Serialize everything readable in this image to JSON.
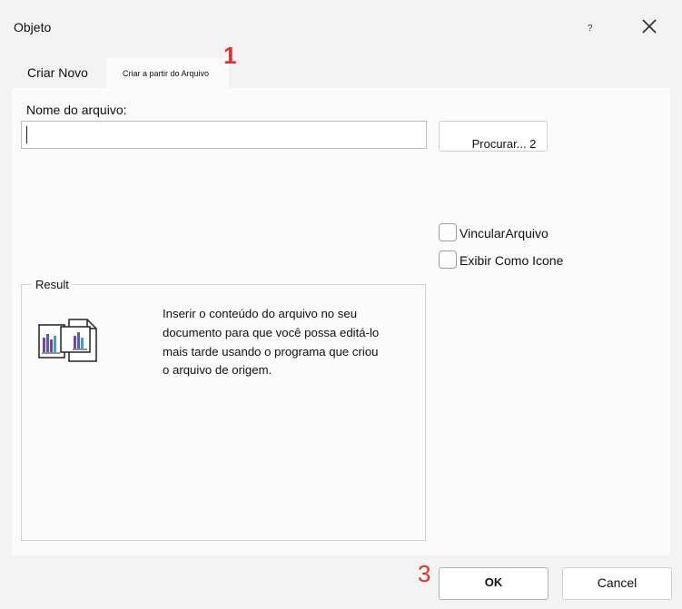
{
  "window": {
    "title": "Objeto",
    "help_glyph": "?",
    "close_icon": "close-icon"
  },
  "tabs": [
    {
      "label": "Criar Novo",
      "active": false
    },
    {
      "label": "Criar a partir do Arquivo",
      "active": true
    }
  ],
  "annotations": {
    "marker_1": "1",
    "marker_3": "3"
  },
  "file": {
    "label": "Nome do arquivo:",
    "value": "",
    "browse_label": "Procurar... 2"
  },
  "options": {
    "link_label": "VincularArquivo",
    "link_checked": false,
    "icon_label": "Exibir Como Icone",
    "icon_checked": false
  },
  "result": {
    "legend": "Result",
    "text": "Inserir o conteúdo do arquivo no seu documento para que você possa editá-lo mais tarde usando o programa  que criou o arquivo de origem.",
    "icon": "embedded-document-icon"
  },
  "footer": {
    "ok_label": "OK",
    "cancel_label": "Cancel"
  },
  "colors": {
    "dialog_bg": "#f3f3f3",
    "panel_bg": "#fbfbfb",
    "marker": "#e0302a"
  }
}
